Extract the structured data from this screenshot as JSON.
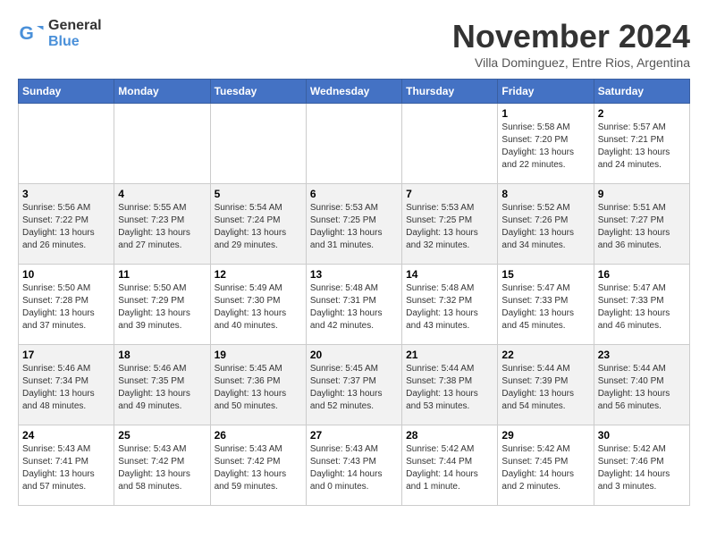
{
  "logo": {
    "general": "General",
    "blue": "Blue"
  },
  "title": "November 2024",
  "subtitle": "Villa Dominguez, Entre Rios, Argentina",
  "weekdays": [
    "Sunday",
    "Monday",
    "Tuesday",
    "Wednesday",
    "Thursday",
    "Friday",
    "Saturday"
  ],
  "weeks": [
    [
      {
        "day": "",
        "info": ""
      },
      {
        "day": "",
        "info": ""
      },
      {
        "day": "",
        "info": ""
      },
      {
        "day": "",
        "info": ""
      },
      {
        "day": "",
        "info": ""
      },
      {
        "day": "1",
        "info": "Sunrise: 5:58 AM\nSunset: 7:20 PM\nDaylight: 13 hours\nand 22 minutes."
      },
      {
        "day": "2",
        "info": "Sunrise: 5:57 AM\nSunset: 7:21 PM\nDaylight: 13 hours\nand 24 minutes."
      }
    ],
    [
      {
        "day": "3",
        "info": "Sunrise: 5:56 AM\nSunset: 7:22 PM\nDaylight: 13 hours\nand 26 minutes."
      },
      {
        "day": "4",
        "info": "Sunrise: 5:55 AM\nSunset: 7:23 PM\nDaylight: 13 hours\nand 27 minutes."
      },
      {
        "day": "5",
        "info": "Sunrise: 5:54 AM\nSunset: 7:24 PM\nDaylight: 13 hours\nand 29 minutes."
      },
      {
        "day": "6",
        "info": "Sunrise: 5:53 AM\nSunset: 7:25 PM\nDaylight: 13 hours\nand 31 minutes."
      },
      {
        "day": "7",
        "info": "Sunrise: 5:53 AM\nSunset: 7:25 PM\nDaylight: 13 hours\nand 32 minutes."
      },
      {
        "day": "8",
        "info": "Sunrise: 5:52 AM\nSunset: 7:26 PM\nDaylight: 13 hours\nand 34 minutes."
      },
      {
        "day": "9",
        "info": "Sunrise: 5:51 AM\nSunset: 7:27 PM\nDaylight: 13 hours\nand 36 minutes."
      }
    ],
    [
      {
        "day": "10",
        "info": "Sunrise: 5:50 AM\nSunset: 7:28 PM\nDaylight: 13 hours\nand 37 minutes."
      },
      {
        "day": "11",
        "info": "Sunrise: 5:50 AM\nSunset: 7:29 PM\nDaylight: 13 hours\nand 39 minutes."
      },
      {
        "day": "12",
        "info": "Sunrise: 5:49 AM\nSunset: 7:30 PM\nDaylight: 13 hours\nand 40 minutes."
      },
      {
        "day": "13",
        "info": "Sunrise: 5:48 AM\nSunset: 7:31 PM\nDaylight: 13 hours\nand 42 minutes."
      },
      {
        "day": "14",
        "info": "Sunrise: 5:48 AM\nSunset: 7:32 PM\nDaylight: 13 hours\nand 43 minutes."
      },
      {
        "day": "15",
        "info": "Sunrise: 5:47 AM\nSunset: 7:33 PM\nDaylight: 13 hours\nand 45 minutes."
      },
      {
        "day": "16",
        "info": "Sunrise: 5:47 AM\nSunset: 7:33 PM\nDaylight: 13 hours\nand 46 minutes."
      }
    ],
    [
      {
        "day": "17",
        "info": "Sunrise: 5:46 AM\nSunset: 7:34 PM\nDaylight: 13 hours\nand 48 minutes."
      },
      {
        "day": "18",
        "info": "Sunrise: 5:46 AM\nSunset: 7:35 PM\nDaylight: 13 hours\nand 49 minutes."
      },
      {
        "day": "19",
        "info": "Sunrise: 5:45 AM\nSunset: 7:36 PM\nDaylight: 13 hours\nand 50 minutes."
      },
      {
        "day": "20",
        "info": "Sunrise: 5:45 AM\nSunset: 7:37 PM\nDaylight: 13 hours\nand 52 minutes."
      },
      {
        "day": "21",
        "info": "Sunrise: 5:44 AM\nSunset: 7:38 PM\nDaylight: 13 hours\nand 53 minutes."
      },
      {
        "day": "22",
        "info": "Sunrise: 5:44 AM\nSunset: 7:39 PM\nDaylight: 13 hours\nand 54 minutes."
      },
      {
        "day": "23",
        "info": "Sunrise: 5:44 AM\nSunset: 7:40 PM\nDaylight: 13 hours\nand 56 minutes."
      }
    ],
    [
      {
        "day": "24",
        "info": "Sunrise: 5:43 AM\nSunset: 7:41 PM\nDaylight: 13 hours\nand 57 minutes."
      },
      {
        "day": "25",
        "info": "Sunrise: 5:43 AM\nSunset: 7:42 PM\nDaylight: 13 hours\nand 58 minutes."
      },
      {
        "day": "26",
        "info": "Sunrise: 5:43 AM\nSunset: 7:42 PM\nDaylight: 13 hours\nand 59 minutes."
      },
      {
        "day": "27",
        "info": "Sunrise: 5:43 AM\nSunset: 7:43 PM\nDaylight: 14 hours\nand 0 minutes."
      },
      {
        "day": "28",
        "info": "Sunrise: 5:42 AM\nSunset: 7:44 PM\nDaylight: 14 hours\nand 1 minute."
      },
      {
        "day": "29",
        "info": "Sunrise: 5:42 AM\nSunset: 7:45 PM\nDaylight: 14 hours\nand 2 minutes."
      },
      {
        "day": "30",
        "info": "Sunrise: 5:42 AM\nSunset: 7:46 PM\nDaylight: 14 hours\nand 3 minutes."
      }
    ]
  ]
}
